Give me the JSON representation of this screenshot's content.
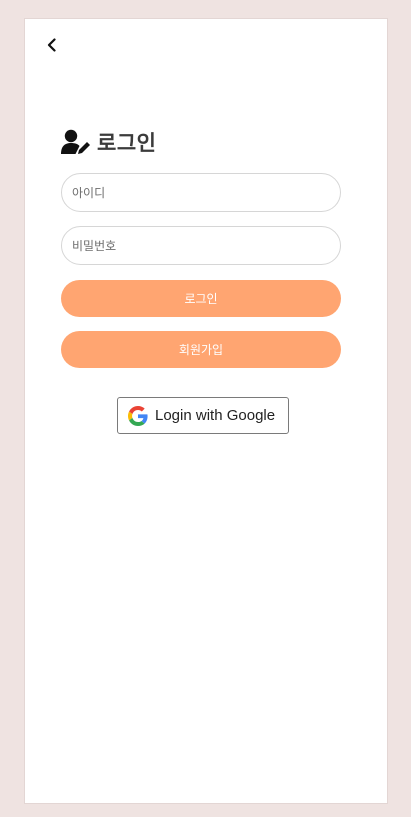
{
  "header": {
    "back_icon": "chevron-left-icon"
  },
  "login": {
    "title_icon": "user-edit-icon",
    "title": "로그인",
    "id_placeholder": "아이디",
    "password_placeholder": "비밀번호",
    "login_button_label": "로그인",
    "signup_button_label": "회원가입",
    "google_icon": "google-g-icon",
    "google_button_label": "Login with Google"
  },
  "colors": {
    "page_background": "#efe3e1",
    "card_background": "#ffffff",
    "accent_button": "#ffa571",
    "button_text": "#ffffff"
  }
}
